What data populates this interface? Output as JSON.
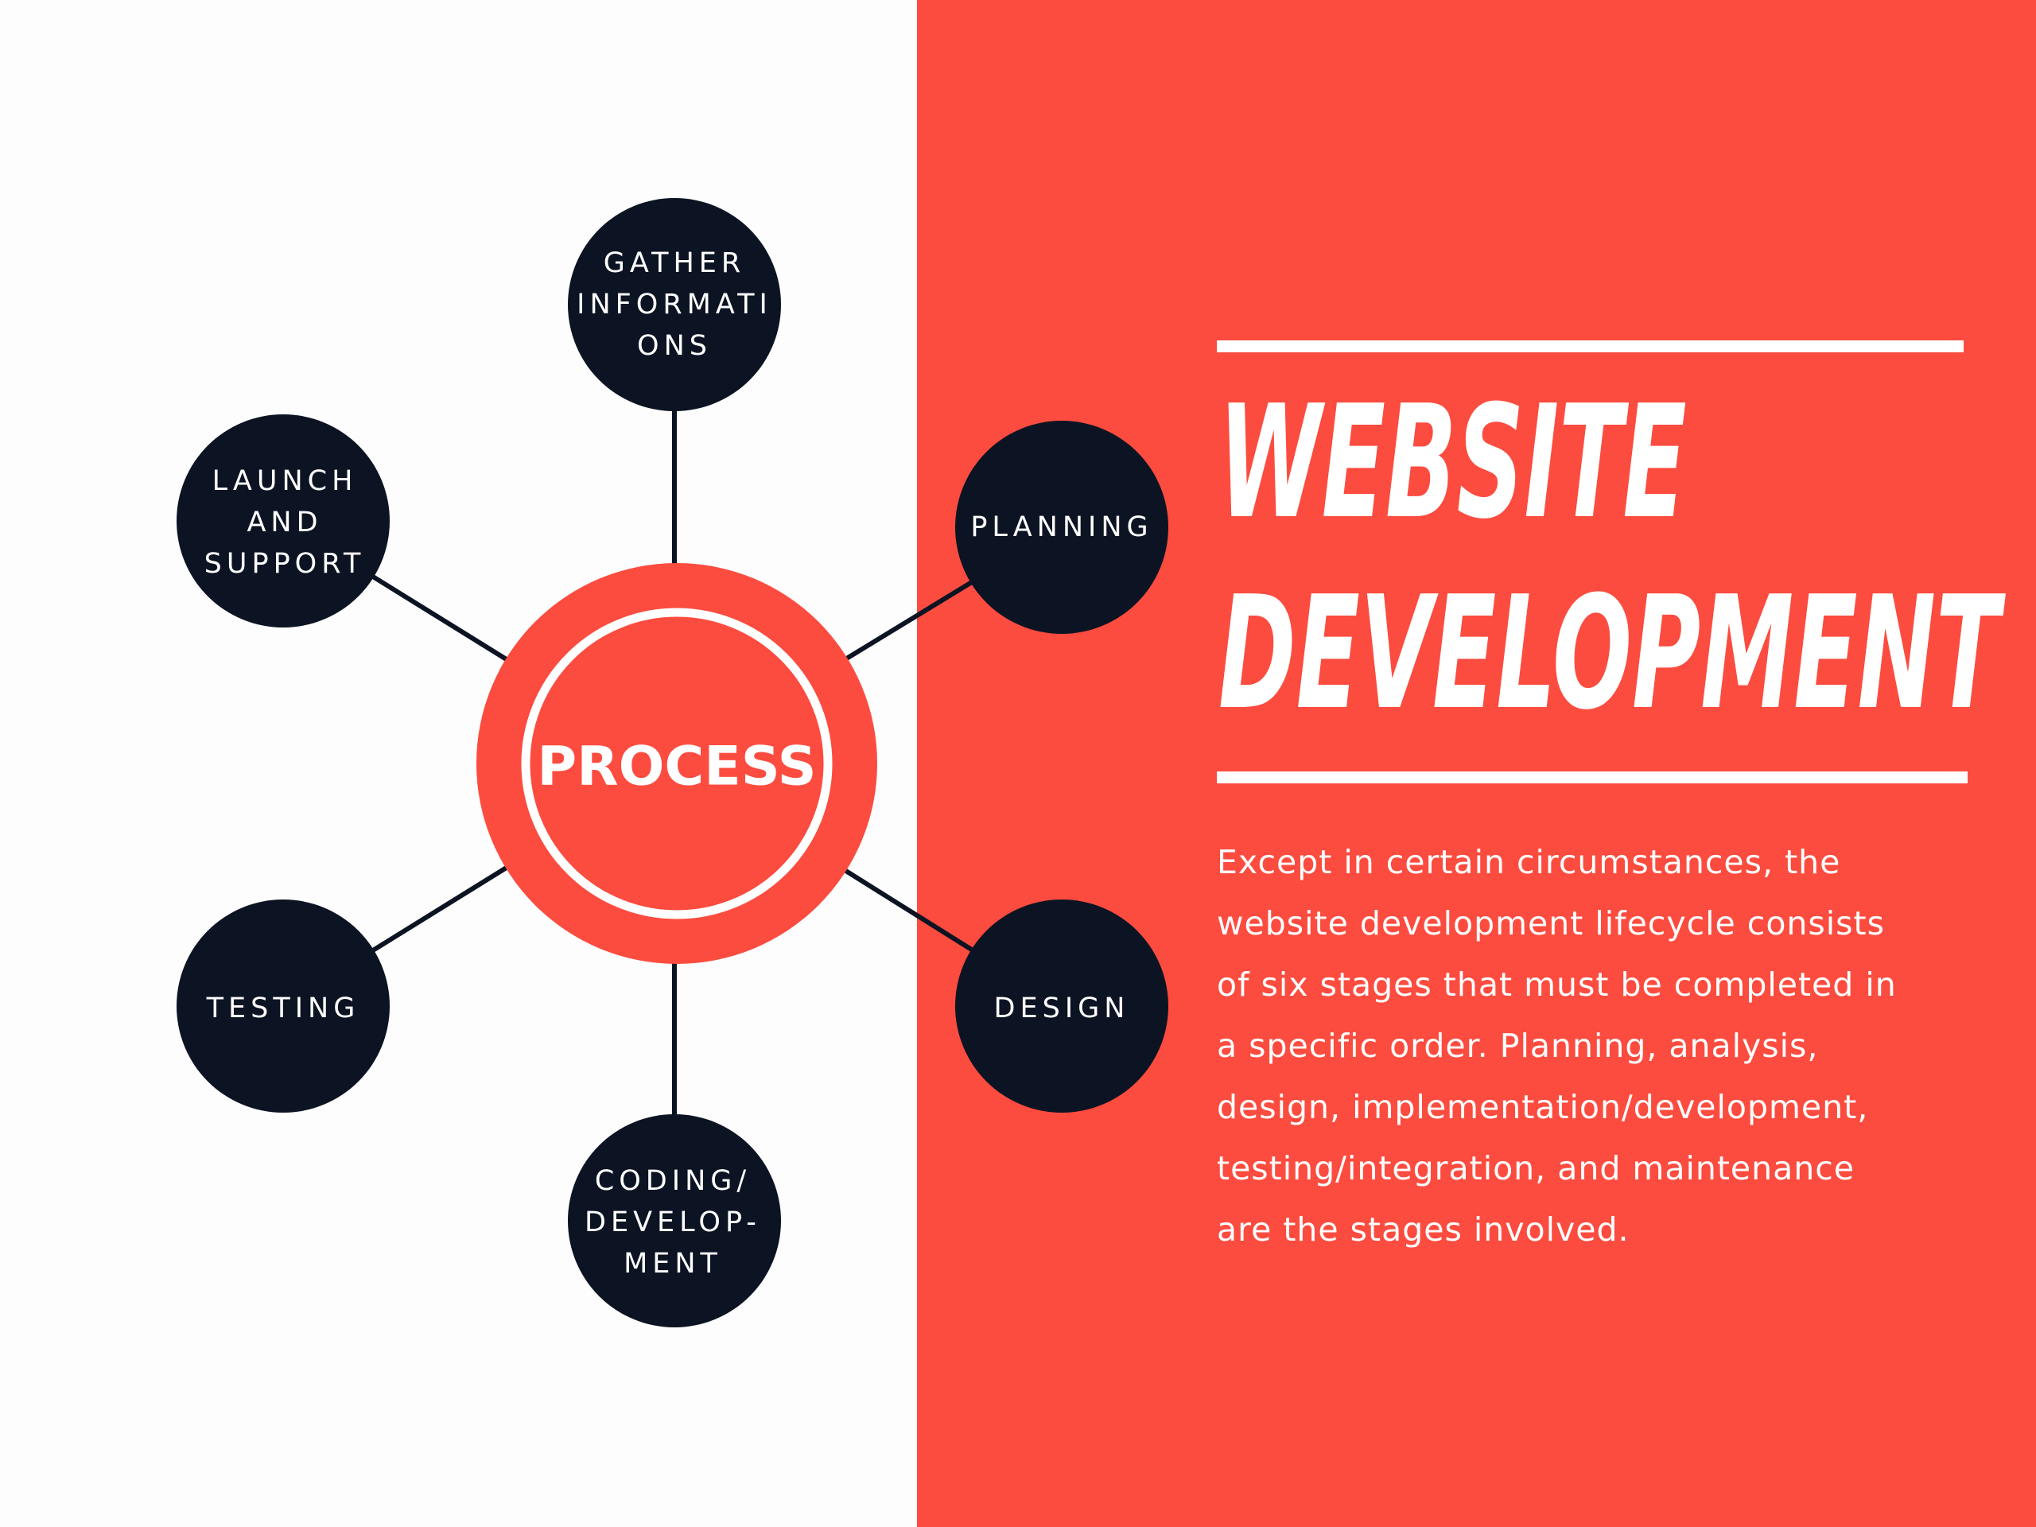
{
  "center": {
    "label": "PROCESS"
  },
  "stages": [
    {
      "id": "gather",
      "label": "GATHER\nINFORMATI\nONS"
    },
    {
      "id": "planning",
      "label": "PLANNING"
    },
    {
      "id": "design",
      "label": "DESIGN"
    },
    {
      "id": "coding",
      "label": "CODING/\nDEVELOP-\nMENT"
    },
    {
      "id": "testing",
      "label": "TESTING"
    },
    {
      "id": "launch",
      "label": "LAUNCH\nAND\nSUPPORT"
    }
  ],
  "title": {
    "line1": "WEBSITE",
    "line2": "DEVELOPMENT"
  },
  "description": "Except in certain circumstances, the website development lifecycle consists of six stages that must be completed in a specific order. Planning, analysis, design, implementation/development, testing/integration, and maintenance are the stages involved.",
  "colors": {
    "accent": "#fc4c3f",
    "node": "#0c1423",
    "background": "#fdfdfd",
    "text_on_accent": "#ffffff"
  }
}
